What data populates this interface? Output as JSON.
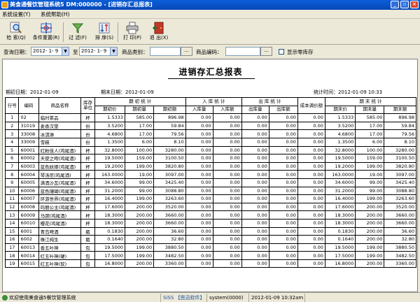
{
  "window": {
    "title": "美食通餐饮管理系统5 DM:000000 - [进销存汇总报表]"
  },
  "menu": [
    "系统设置(Y)",
    "系统帮助(H)"
  ],
  "toolbar": [
    {
      "label": "检 索(Q)",
      "icon": "magnifier-icon"
    },
    {
      "label": "条件重置(R)",
      "icon": "reset-conditions-icon"
    },
    {
      "label": "过 滤(F)",
      "icon": "filter-icon"
    },
    {
      "label": "排 序(S)",
      "icon": "sort-icon"
    },
    {
      "label": "打 印(P)",
      "icon": "printer-icon"
    },
    {
      "label": "退 出(X)",
      "icon": "exit-icon"
    }
  ],
  "filter": {
    "start_label": "查询日期：",
    "start_date": "2012- 1- 9",
    "to_label": "至",
    "end_date": "2012- 1- 9",
    "category_label": "商品类别：",
    "category_value": "",
    "category_btn": "...",
    "code_label": "商品编码：",
    "code_value": "",
    "code_btn": "...",
    "zero_stock_label": "显示零库存"
  },
  "report": {
    "title": "进销存汇总报表",
    "start_period": "期初日期：2012-01-09",
    "end_period": "期末日期：2012-01-09",
    "stat_time": "统计时间：2012-01-09 10:33",
    "group_headers": [
      "期 初 统 计",
      "入 库 统 计",
      "出 库 统 计",
      "期 末 统 计"
    ],
    "headers": {
      "seq": "行号",
      "code": "编码",
      "name": "商品名称",
      "unit": "库存单位",
      "init_price": "期初价",
      "init_qty": "期初量",
      "init_amt": "期初额",
      "in_qty": "入库量",
      "in_amt": "入库额",
      "out_qty": "出库量",
      "out_amt": "出库额",
      "cost_adj": "成本调价额",
      "end_price": "期末价",
      "end_qty": "期末量",
      "end_amt": "期末额"
    },
    "rows": [
      [
        "1",
        "02",
        "临时茶品",
        "杯",
        "1.5333",
        "585.00",
        "896.98",
        "0.00",
        "0.00",
        "0.00",
        "0.00",
        "0.00",
        "1.5333",
        "585.00",
        "896.98"
      ],
      [
        "2",
        "31019",
        "麦香汉堡",
        "份",
        "3.5200",
        "17.00",
        "59.84",
        "0.00",
        "0.00",
        "0.00",
        "0.00",
        "0.00",
        "3.5200",
        "17.00",
        "59.84"
      ],
      [
        "3",
        "33008",
        "冰淇淋",
        "份",
        "4.6800",
        "17.00",
        "79.56",
        "0.00",
        "0.00",
        "0.00",
        "0.00",
        "0.00",
        "4.6800",
        "17.00",
        "79.56"
      ],
      [
        "4",
        "33009",
        "雪糕",
        "份",
        "1.3500",
        "6.00",
        "8.10",
        "0.00",
        "0.00",
        "0.00",
        "0.00",
        "0.00",
        "1.3500",
        "6.00",
        "8.10"
      ],
      [
        "5",
        "60001",
        "红粉佳人(鸡尾酒)",
        "杯",
        "32.8000",
        "100.00",
        "3280.00",
        "0.00",
        "0.00",
        "0.00",
        "0.00",
        "0.00",
        "32.8000",
        "100.00",
        "3280.00"
      ],
      [
        "6",
        "60002",
        "天使之吻(鸡尾酒)",
        "杯",
        "19.5000",
        "159.00",
        "3100.50",
        "0.00",
        "0.00",
        "0.00",
        "0.00",
        "0.00",
        "19.5000",
        "159.00",
        "3100.50"
      ],
      [
        "7",
        "60003",
        "蓝色妖姬(鸡尾酒)",
        "杯",
        "19.2000",
        "199.00",
        "3820.80",
        "0.00",
        "0.00",
        "0.00",
        "0.00",
        "0.00",
        "19.2000",
        "199.00",
        "3820.80"
      ],
      [
        "8",
        "60004",
        "琴汤尼(鸡尾酒)",
        "杯",
        "163.0000",
        "19.00",
        "3097.00",
        "0.00",
        "0.00",
        "0.00",
        "0.00",
        "0.00",
        "163.0000",
        "19.00",
        "3097.00"
      ],
      [
        "9",
        "60005",
        "满酒沙瓦(鸡尾酒)",
        "杯",
        "34.6000",
        "99.00",
        "3425.40",
        "0.00",
        "0.00",
        "0.00",
        "0.00",
        "0.00",
        "34.6000",
        "99.00",
        "3425.40"
      ],
      [
        "10",
        "60006",
        "蓝色珊瑚(鸡尾酒)",
        "杯",
        "31.2000",
        "99.00",
        "3088.80",
        "0.00",
        "0.00",
        "0.00",
        "0.00",
        "0.00",
        "31.2000",
        "99.00",
        "3088.80"
      ],
      [
        "11",
        "60007",
        "环游世界(鸡尾酒)",
        "杯",
        "16.4000",
        "199.00",
        "3263.60",
        "0.00",
        "0.00",
        "0.00",
        "0.00",
        "0.00",
        "16.4000",
        "199.00",
        "3263.60"
      ],
      [
        "12",
        "60008",
        "玛丽公主(鸡尾酒)",
        "杯",
        "17.6000",
        "200.00",
        "3520.00",
        "0.00",
        "0.00",
        "0.00",
        "0.00",
        "0.00",
        "17.6000",
        "200.00",
        "3520.00"
      ],
      [
        "13",
        "60009",
        "马颈(鸡尾酒)",
        "杯",
        "18.3000",
        "200.00",
        "3660.00",
        "0.00",
        "0.00",
        "0.00",
        "0.00",
        "0.00",
        "18.3000",
        "200.00",
        "3660.00"
      ],
      [
        "14",
        "60010",
        "樱花(鸡尾酒)",
        "杯",
        "18.3000",
        "200.00",
        "3660.00",
        "0.00",
        "0.00",
        "0.00",
        "0.00",
        "0.00",
        "18.3000",
        "200.00",
        "3660.00"
      ],
      [
        "15",
        "6001",
        "青岛啤酒",
        "瓶",
        "0.1830",
        "200.00",
        "36.60",
        "0.00",
        "0.00",
        "0.00",
        "0.00",
        "0.00",
        "0.1830",
        "200.00",
        "36.60"
      ],
      [
        "16",
        "6002",
        "珠江纯生",
        "瓶",
        "0.1640",
        "200.00",
        "32.80",
        "0.00",
        "0.00",
        "0.00",
        "0.00",
        "0.00",
        "0.1640",
        "200.00",
        "32.80"
      ],
      [
        "17",
        "60013",
        "香五叶神",
        "包",
        "19.5000",
        "199.00",
        "3880.50",
        "0.00",
        "0.00",
        "0.00",
        "0.00",
        "0.00",
        "19.5000",
        "199.00",
        "3880.50"
      ],
      [
        "18",
        "60014",
        "红五叶神(硬)",
        "包",
        "17.5000",
        "199.00",
        "3482.50",
        "0.00",
        "0.00",
        "0.00",
        "0.00",
        "0.00",
        "17.5000",
        "199.00",
        "3482.50"
      ],
      [
        "19",
        "60015",
        "红五叶神(软)",
        "包",
        "16.8000",
        "200.00",
        "3360.00",
        "0.00",
        "0.00",
        "0.00",
        "0.00",
        "0.00",
        "16.8000",
        "200.00",
        "3360.00"
      ]
    ]
  },
  "status": {
    "welcome": "欢迎使用美食通5餐饮管理系统",
    "brand": "SiSS 【思迅软件】",
    "user": "system(0000)",
    "datetime": "2012-01-09 10:32am"
  },
  "colors": {
    "title_bar": "#0a5fd8",
    "chrome": "#ece9d8"
  }
}
